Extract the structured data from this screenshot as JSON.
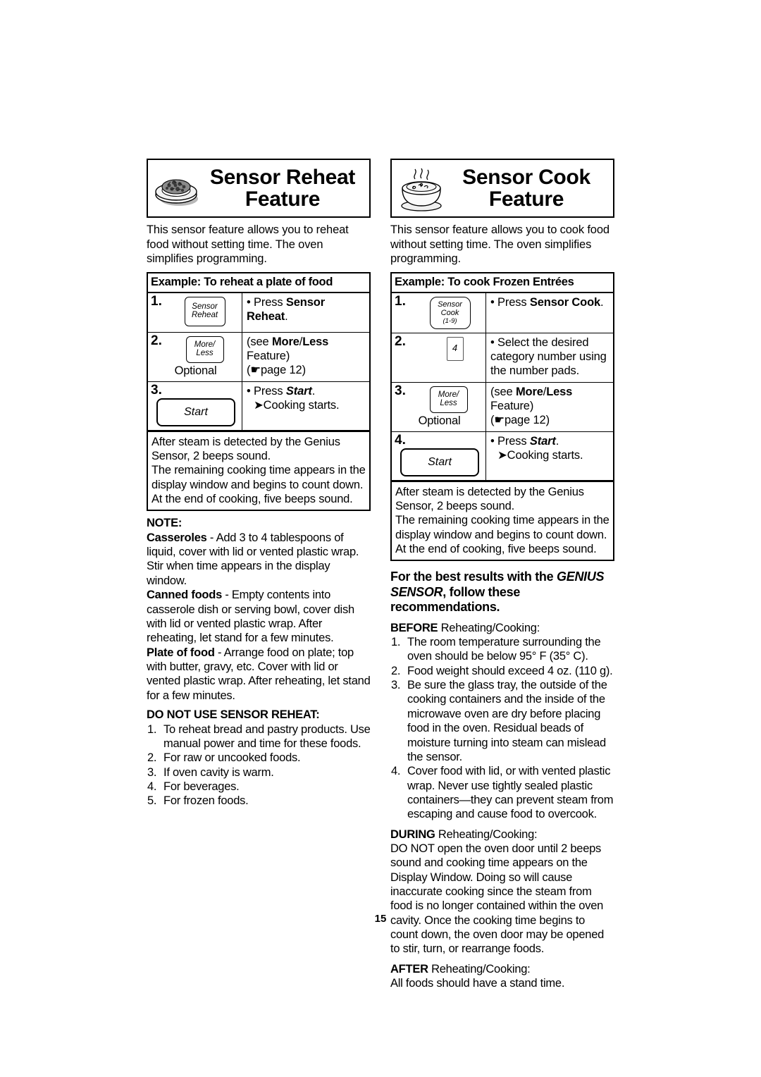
{
  "page_number": "15",
  "left": {
    "banner": {
      "title_line1": "Sensor Reheat",
      "title_line2": "Feature",
      "icon": "plate-of-food-icon"
    },
    "intro": "This sensor feature allows you to reheat food without setting time. The oven simplifies programming.",
    "example_caption": "Example: To reheat a plate of food",
    "steps": [
      {
        "num": "1.",
        "key_label_line1": "Sensor",
        "key_label_line2": "Reheat",
        "instruction_bullet": "• Press ",
        "instruction_bold": "Sensor Reheat",
        "instruction_tail": "."
      },
      {
        "num": "2.",
        "key_label_line1": "More/",
        "key_label_line2": "Less",
        "optional": "Optional",
        "line1_pre": "(see ",
        "line1_bold1": "More",
        "line1_mid": "/",
        "line1_bold2": "Less",
        "line2": "Feature)",
        "line3": "(☛page 12)"
      },
      {
        "num": "3.",
        "key_label": "Start",
        "line1_pre": "• Press ",
        "line1_bold": "Start",
        "line1_tail": ".",
        "line2": "➤Cooking starts."
      }
    ],
    "after_note": [
      "After steam is detected by the Genius Sensor, 2 beeps sound.",
      "The remaining cooking time appears in the display window and begins to count down. At the end of cooking, five beeps sound."
    ],
    "note_heading": "NOTE:",
    "notes": [
      {
        "term": "Casseroles",
        "text": " - Add 3 to 4 tablespoons of liquid, cover with lid or vented plastic wrap. Stir when time appears in the display window."
      },
      {
        "term": "Canned foods",
        "text": " - Empty contents into casserole dish or serving bowl, cover dish with lid or vented plastic wrap. After reheating, let stand for a few minutes."
      },
      {
        "term": "Plate of food",
        "text": " - Arrange food on plate; top with butter, gravy, etc. Cover with lid or vented plastic wrap. After reheating, let stand for a few minutes."
      }
    ],
    "donot_heading": "DO NOT USE SENSOR REHEAT:",
    "donot_items": [
      {
        "n": "1.",
        "text": "To reheat bread and pastry products. Use manual power and time for these foods."
      },
      {
        "n": "2.",
        "text": "For raw or uncooked foods."
      },
      {
        "n": "3.",
        "text": "If oven cavity is warm."
      },
      {
        "n": "4.",
        "text": "For beverages."
      },
      {
        "n": "5.",
        "text": "For frozen foods."
      }
    ]
  },
  "right": {
    "banner": {
      "title_line1": "Sensor Cook",
      "title_line2": "Feature",
      "icon": "steaming-bowl-icon"
    },
    "intro": "This sensor feature allows you to cook food without setting time. The oven simplifies programming.",
    "example_caption": "Example: To cook Frozen Entrées",
    "steps": [
      {
        "num": "1.",
        "key_label_line1": "Sensor",
        "key_label_line2": "Cook",
        "key_label_line3": "(1-9)",
        "instruction_bullet": "• Press ",
        "instruction_bold": "Sensor Cook",
        "instruction_tail": "."
      },
      {
        "num": "2.",
        "key_label": "4",
        "instruction": "• Select the desired category number using the number pads."
      },
      {
        "num": "3.",
        "key_label_line1": "More/",
        "key_label_line2": "Less",
        "optional": "Optional",
        "line1_pre": "(see ",
        "line1_bold1": "More",
        "line1_mid": "/",
        "line1_bold2": "Less",
        "line2": "Feature)",
        "line3": "(☛page 12)"
      },
      {
        "num": "4.",
        "key_label": "Start",
        "line1_pre": "• Press ",
        "line1_bold": "Start",
        "line1_tail": ".",
        "line2": "➤Cooking starts."
      }
    ],
    "after_note": [
      "After steam is detected by the Genius Sensor, 2 beeps sound.",
      "The remaining cooking time appears in the display window and begins to count down. At the end of cooking, five beeps sound."
    ],
    "rec_head_line1": "For the best results with the ",
    "rec_head_ital": "GENIUS SENSOR",
    "rec_head_rest": ", follow these recommendations.",
    "before_label": "BEFORE",
    "before_suffix": " Reheating/Cooking:",
    "before_items": [
      {
        "n": "1.",
        "text": "The room temperature surrounding the oven should be below 95° F (35° C)."
      },
      {
        "n": "2.",
        "text": "Food weight should exceed 4 oz. (110 g)."
      },
      {
        "n": "3.",
        "text": "Be sure the glass tray, the outside of the cooking containers and the inside of the microwave oven are dry before placing food in the oven. Residual beads of moisture turning into steam can mislead the sensor."
      },
      {
        "n": "4.",
        "text": "Cover food with lid, or with vented plastic wrap. Never use tightly sealed plastic containers—they can prevent steam from escaping and cause food to overcook."
      }
    ],
    "during_label": "DURING",
    "during_suffix": " Reheating/Cooking:",
    "during_text": "DO NOT open the oven door until 2 beeps sound and cooking time appears on the Display Window.  Doing so will cause inaccurate cooking since the steam from food is no longer contained within the oven cavity. Once the cooking time begins to count down, the oven door may be opened to stir, turn, or rearrange foods.",
    "after_label": "AFTER",
    "after_suffix": " Reheating/Cooking:",
    "after_text": "All foods should have a stand time."
  }
}
